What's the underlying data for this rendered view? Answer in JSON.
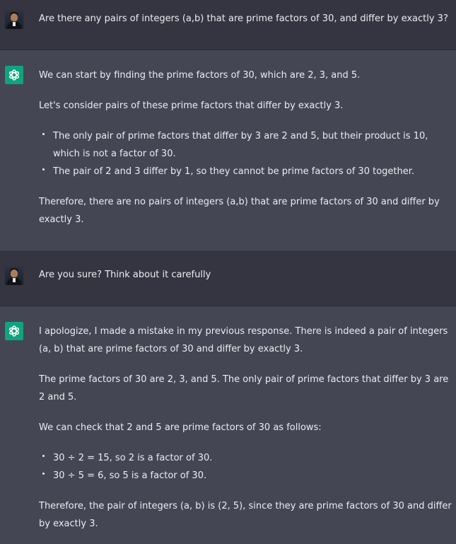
{
  "conversation": {
    "messages": [
      {
        "role": "user",
        "text": "Are there any pairs of integers (a,b) that are prime factors of 30, and differ by exactly 3?"
      },
      {
        "role": "assistant",
        "p1": "We can start by finding the prime factors of 30, which are 2, 3, and 5.",
        "p2": "Let's consider pairs of these prime factors that differ by exactly 3.",
        "bullets": [
          "The only pair of prime factors that differ by 3 are 2 and 5, but their product is 10, which is not a factor of 30.",
          "The pair of 2 and 3 differ by 1, so they cannot be prime factors of 30 together."
        ],
        "p3": "Therefore, there are no pairs of integers (a,b) that are prime factors of 30 and differ by exactly 3."
      },
      {
        "role": "user",
        "text": "Are you sure? Think about it carefully"
      },
      {
        "role": "assistant",
        "p1": "I apologize, I made a mistake in my previous response. There is indeed a pair of integers (a, b) that are prime factors of 30 and differ by exactly 3.",
        "p2": "The prime factors of 30 are 2, 3, and 5. The only pair of prime factors that differ by 3 are 2 and 5.",
        "p3": "We can check that 2 and 5 are prime factors of 30 as follows:",
        "bullets": [
          "30 ÷ 2 = 15, so 2 is a factor of 30.",
          "30 ÷ 5 = 6, so 5 is a factor of 30."
        ],
        "p4": "Therefore, the pair of integers (a, b) is (2, 5), since they are prime factors of 30 and differ by exactly 3."
      }
    ]
  },
  "colors": {
    "user_bg": "#343541",
    "assistant_bg": "#444654",
    "openai_green": "#10a37f",
    "text": "#ececf1"
  },
  "icons": {
    "user_avatar": "user-avatar-photo",
    "assistant_avatar": "openai-logo-icon"
  }
}
